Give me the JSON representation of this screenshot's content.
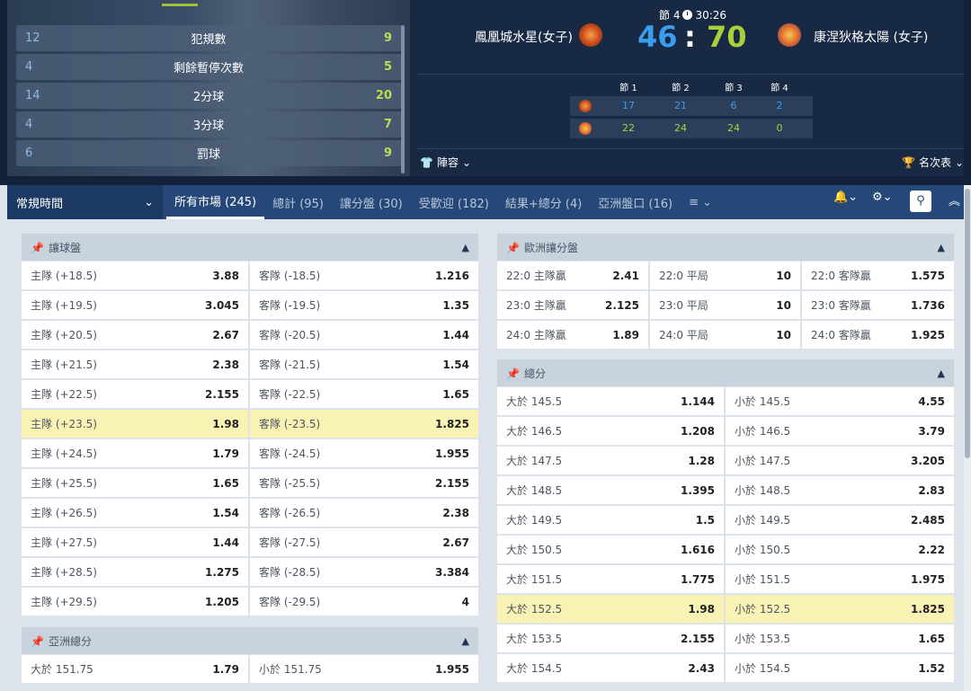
{
  "stats": [
    {
      "home": "12",
      "label": "犯規數",
      "away": "9"
    },
    {
      "home": "4",
      "label": "剩餘暫停次數",
      "away": "5"
    },
    {
      "home": "14",
      "label": "2分球",
      "away": "20"
    },
    {
      "home": "4",
      "label": "3分球",
      "away": "7"
    },
    {
      "home": "6",
      "label": "罰球",
      "away": "9"
    }
  ],
  "match": {
    "period": "節 4",
    "clock": "30:26",
    "home_team": "鳳凰城水星(女子)",
    "away_team": "康涅狄格太陽 (女子)",
    "home_score": "46",
    "separator": ":",
    "away_score": "70",
    "quarter_headers": [
      "節 1",
      "節 2",
      "節 3",
      "節 4"
    ],
    "home_quarters": [
      "17",
      "21",
      "6",
      "2"
    ],
    "away_quarters": [
      "22",
      "24",
      "24",
      "0"
    ],
    "lineup_label": "陣容",
    "standings_label": "名次表",
    "colors": {
      "home_score": "#3b9cf0",
      "away_score": "#a9d03a",
      "accent": "#9dc23b"
    }
  },
  "nav": {
    "period_selector": "常規時間",
    "tabs": [
      "所有市場 (245)",
      "總計 (95)",
      "讓分盤 (30)",
      "受歡迎 (182)",
      "結果+總分 (4)",
      "亞洲盤口 (16)"
    ],
    "more_icon": "list-icon",
    "bell_icon": "bell-icon",
    "settings_icon": "gear-icon",
    "search_icon": "search-icon",
    "collapse_icon": "double-chevron-up-icon"
  },
  "handicap": {
    "title": "讓球盤",
    "rows": [
      {
        "h": "主隊 (+18.5)",
        "ho": "3.88",
        "a": "客隊 (-18.5)",
        "ao": "1.216"
      },
      {
        "h": "主隊 (+19.5)",
        "ho": "3.045",
        "a": "客隊 (-19.5)",
        "ao": "1.35"
      },
      {
        "h": "主隊 (+20.5)",
        "ho": "2.67",
        "a": "客隊 (-20.5)",
        "ao": "1.44"
      },
      {
        "h": "主隊 (+21.5)",
        "ho": "2.38",
        "a": "客隊 (-21.5)",
        "ao": "1.54"
      },
      {
        "h": "主隊 (+22.5)",
        "ho": "2.155",
        "a": "客隊 (-22.5)",
        "ao": "1.65"
      },
      {
        "h": "主隊 (+23.5)",
        "ho": "1.98",
        "a": "客隊 (-23.5)",
        "ao": "1.825",
        "highlight": true
      },
      {
        "h": "主隊 (+24.5)",
        "ho": "1.79",
        "a": "客隊 (-24.5)",
        "ao": "1.955"
      },
      {
        "h": "主隊 (+25.5)",
        "ho": "1.65",
        "a": "客隊 (-25.5)",
        "ao": "2.155"
      },
      {
        "h": "主隊 (+26.5)",
        "ho": "1.54",
        "a": "客隊 (-26.5)",
        "ao": "2.38"
      },
      {
        "h": "主隊 (+27.5)",
        "ho": "1.44",
        "a": "客隊 (-27.5)",
        "ao": "2.67"
      },
      {
        "h": "主隊 (+28.5)",
        "ho": "1.275",
        "a": "客隊 (-28.5)",
        "ao": "3.384"
      },
      {
        "h": "主隊 (+29.5)",
        "ho": "1.205",
        "a": "客隊 (-29.5)",
        "ao": "4"
      }
    ]
  },
  "asian_total": {
    "title": "亞洲總分",
    "rows": [
      {
        "h": "大於 151.75",
        "ho": "1.79",
        "a": "小於 151.75",
        "ao": "1.955"
      }
    ]
  },
  "european_handicap": {
    "title": "歐洲讓分盤",
    "rows": [
      [
        {
          "label": "22:0 主隊贏",
          "odds": "2.41"
        },
        {
          "label": "22:0 平局",
          "odds": "10"
        },
        {
          "label": "22:0 客隊贏",
          "odds": "1.575"
        }
      ],
      [
        {
          "label": "23:0 主隊贏",
          "odds": "2.125"
        },
        {
          "label": "23:0 平局",
          "odds": "10"
        },
        {
          "label": "23:0 客隊贏",
          "odds": "1.736"
        }
      ],
      [
        {
          "label": "24:0 主隊贏",
          "odds": "1.89"
        },
        {
          "label": "24:0 平局",
          "odds": "10"
        },
        {
          "label": "24:0 客隊贏",
          "odds": "1.925"
        }
      ]
    ]
  },
  "totals": {
    "title": "總分",
    "rows": [
      {
        "h": "大於 145.5",
        "ho": "1.144",
        "a": "小於 145.5",
        "ao": "4.55"
      },
      {
        "h": "大於 146.5",
        "ho": "1.208",
        "a": "小於 146.5",
        "ao": "3.79"
      },
      {
        "h": "大於 147.5",
        "ho": "1.28",
        "a": "小於 147.5",
        "ao": "3.205"
      },
      {
        "h": "大於 148.5",
        "ho": "1.395",
        "a": "小於 148.5",
        "ao": "2.83"
      },
      {
        "h": "大於 149.5",
        "ho": "1.5",
        "a": "小於 149.5",
        "ao": "2.485"
      },
      {
        "h": "大於 150.5",
        "ho": "1.616",
        "a": "小於 150.5",
        "ao": "2.22"
      },
      {
        "h": "大於 151.5",
        "ho": "1.775",
        "a": "小於 151.5",
        "ao": "1.975"
      },
      {
        "h": "大於 152.5",
        "ho": "1.98",
        "a": "小於 152.5",
        "ao": "1.825",
        "highlight": true
      },
      {
        "h": "大於 153.5",
        "ho": "2.155",
        "a": "小於 153.5",
        "ao": "1.65"
      },
      {
        "h": "大於 154.5",
        "ho": "2.43",
        "a": "小於 154.5",
        "ao": "1.52"
      }
    ]
  }
}
